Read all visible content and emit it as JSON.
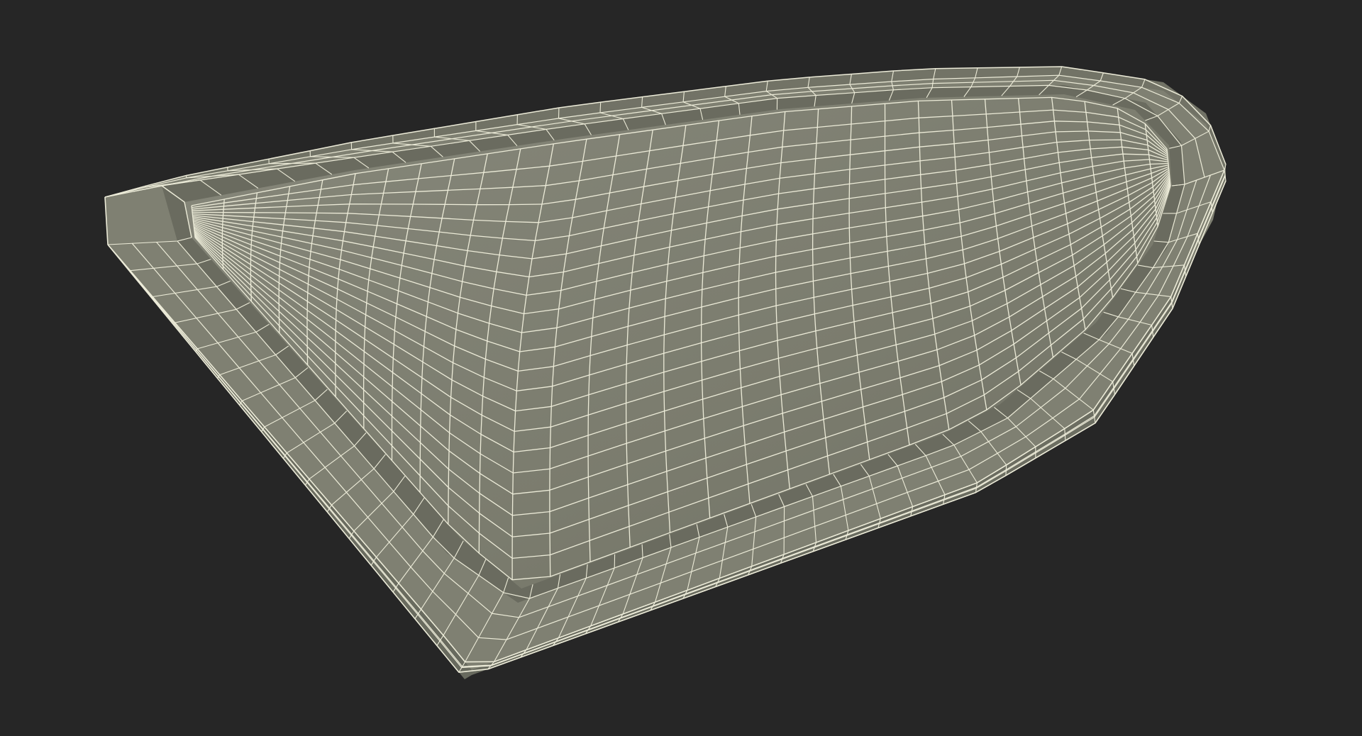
{
  "scene": {
    "background_color": "#262626",
    "surface_color": "#7b7c6e",
    "surface_shadow_color": "#5d5e53",
    "surface_light_color": "#8a8b7c",
    "wire_color": "#ecebd8",
    "render_mode": "wireframe-on-shaded",
    "model": "tray-panel"
  }
}
